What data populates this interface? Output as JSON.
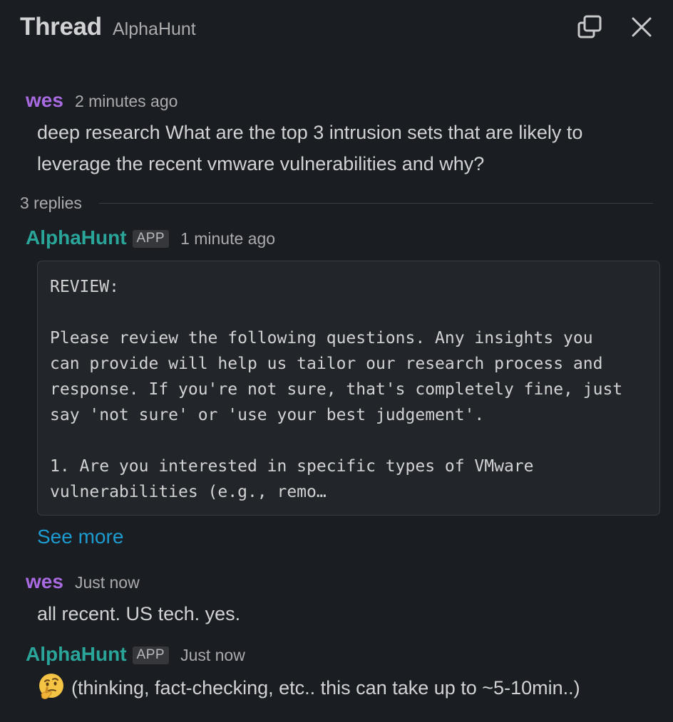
{
  "header": {
    "title": "Thread",
    "channel": "AlphaHunt"
  },
  "messages": [
    {
      "sender": "wes",
      "timestamp": "2 minutes ago",
      "lines": [
        "deep research What are the top 3 intrusion sets that are likely to",
        "leverage the recent vmware vulnerabilities and why?"
      ]
    },
    {
      "sender": "AlphaHunt",
      "badge": "APP",
      "timestamp": "1 minute ago",
      "code_lines": [
        "REVIEW:",
        "",
        "Please review the following questions. Any insights you",
        "can provide will help us tailor our research process and",
        "response. If you're not sure, that's completely fine, just",
        "say 'not sure' or 'use your best judgement'.",
        "",
        "1. Are you interested in specific types of VMware",
        "vulnerabilities (e.g., remo…"
      ],
      "see_more": "See more"
    },
    {
      "sender": "wes",
      "timestamp": "Just now",
      "text": "all recent. US tech. yes."
    },
    {
      "sender": "AlphaHunt",
      "badge": "APP",
      "timestamp": "Just now",
      "emoji": "thinking-face",
      "text": "(thinking, fact-checking, etc.. this can take up to ~5-10min..)"
    }
  ],
  "thread": {
    "replies_label": "3 replies"
  },
  "colors": {
    "background": "#1a1d21",
    "user_name": "#a86ae0",
    "app_name": "#2aa59a",
    "link": "#1d9bd1"
  },
  "icons": {
    "expand": "open-in-new-window-icon",
    "close": "close-icon"
  }
}
